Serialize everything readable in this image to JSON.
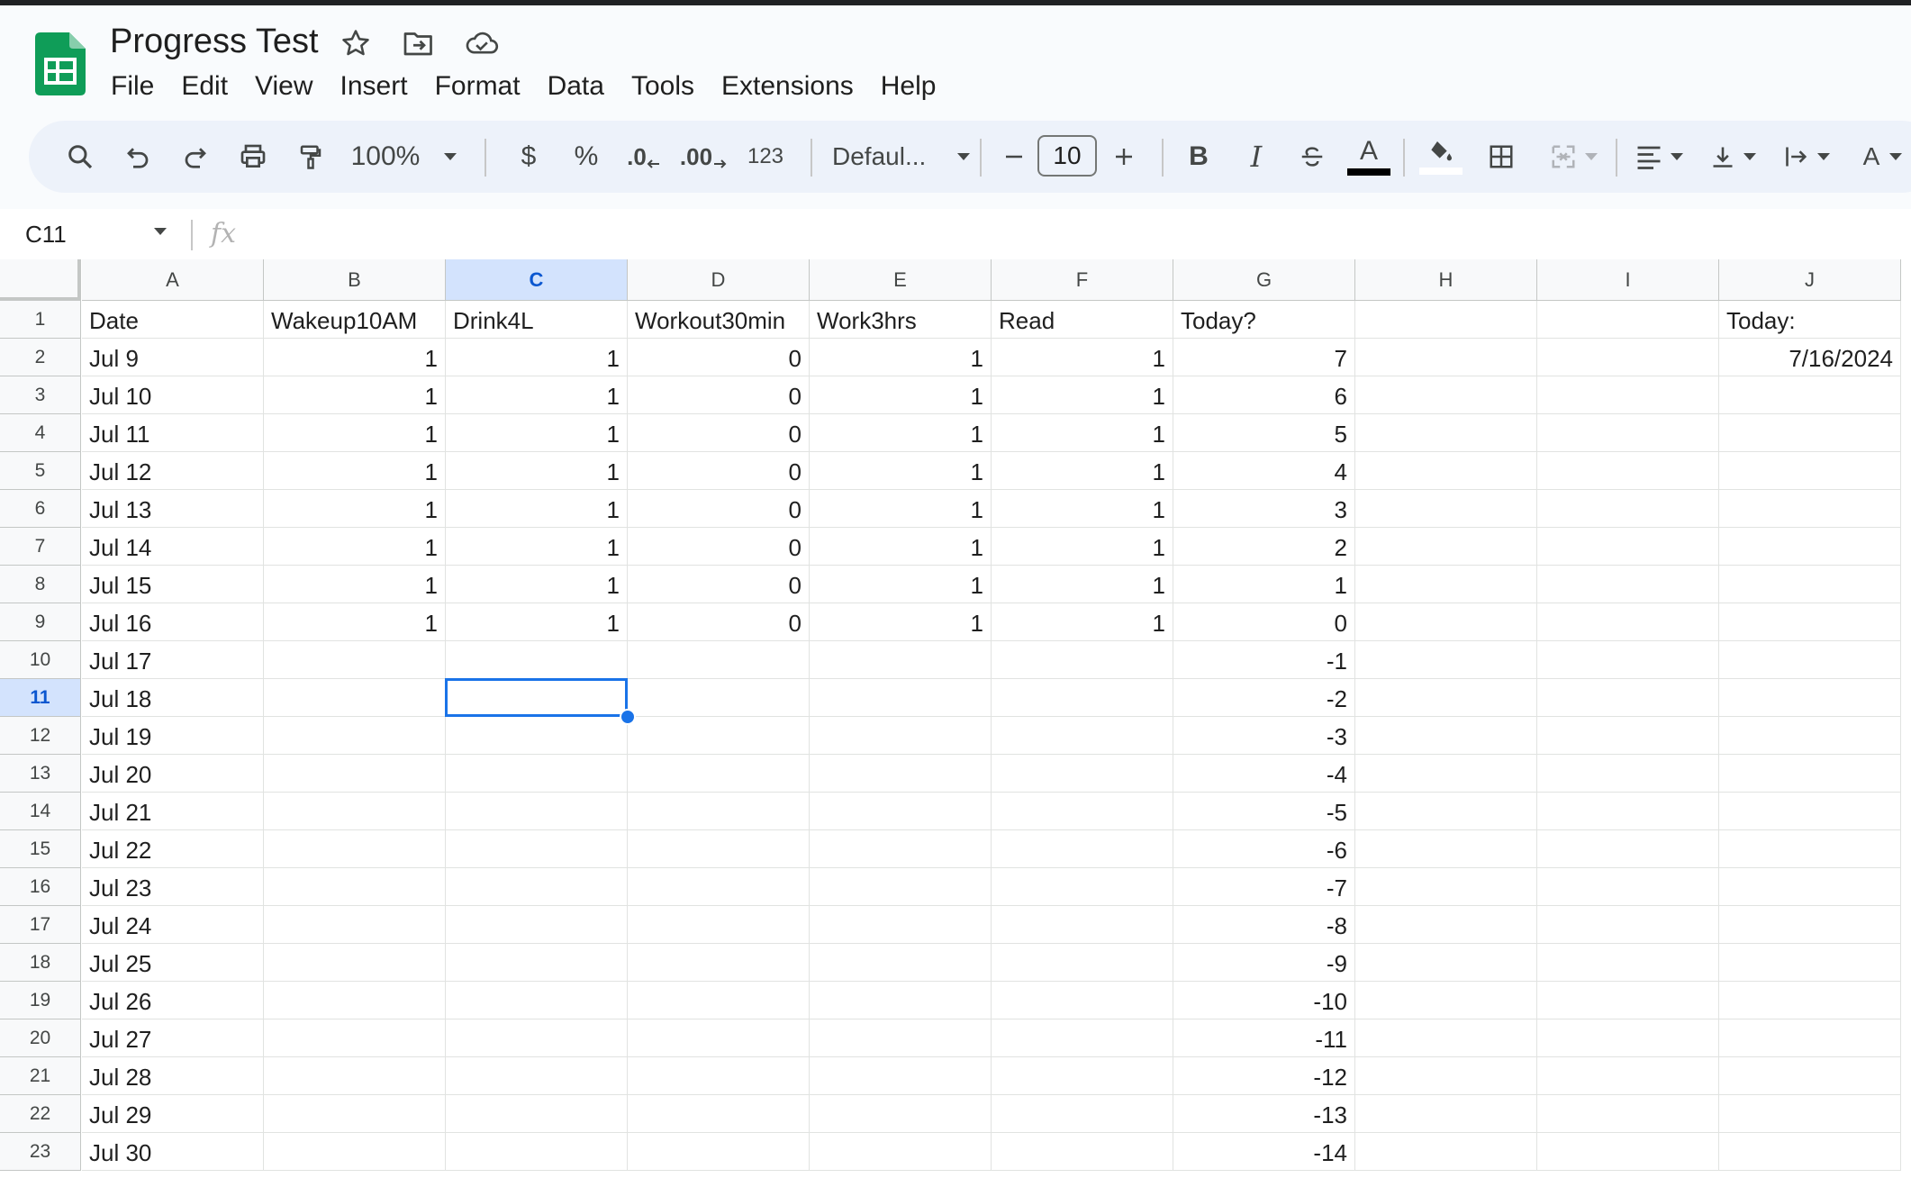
{
  "app": {
    "doc_title": "Progress Test",
    "menu": [
      "File",
      "Edit",
      "View",
      "Insert",
      "Format",
      "Data",
      "Tools",
      "Extensions",
      "Help"
    ],
    "title_icons": [
      "star-icon",
      "move-to-folder-icon",
      "cloud-status-icon"
    ]
  },
  "toolbar": {
    "zoom": "100%",
    "currency": "$",
    "percent": "%",
    "decrease_decimal": ".0",
    "increase_decimal": ".00",
    "more_formats": "123",
    "font": "Defaul...",
    "font_size": "10",
    "bold": "B",
    "italic": "I",
    "text_color_letter": "A",
    "rotation_letter": "A",
    "icons": [
      "search-icon",
      "undo-icon",
      "redo-icon",
      "print-icon",
      "paint-format-icon",
      "bold-icon",
      "italic-icon",
      "strikethrough-icon",
      "text-color-icon",
      "fill-color-icon",
      "borders-icon",
      "merge-cells-icon",
      "align-left-icon",
      "valign-bottom-icon",
      "text-wrap-icon",
      "text-rotation-icon"
    ]
  },
  "formula_bar": {
    "name_box": "C11",
    "fx_label": "fx",
    "value": ""
  },
  "sheet": {
    "columns": [
      "A",
      "B",
      "C",
      "D",
      "E",
      "F",
      "G",
      "H",
      "I",
      "J"
    ],
    "active_column": "C",
    "active_row": "11",
    "selected_cell": "C11",
    "row_numbers": [
      "1",
      "2",
      "3",
      "4",
      "5",
      "6",
      "7",
      "8",
      "9",
      "10",
      "11",
      "12",
      "13",
      "14",
      "15",
      "16",
      "17",
      "18",
      "19",
      "20",
      "21",
      "22",
      "23"
    ],
    "header_row": [
      "Date",
      "Wakeup10AM",
      "Drink4L",
      "Workout30min",
      "Work3hrs",
      "Read",
      "Today?",
      "",
      "",
      "Today:"
    ],
    "rows": [
      [
        "Jul 9",
        "1",
        "1",
        "0",
        "1",
        "1",
        "7",
        "",
        "",
        "7/16/2024"
      ],
      [
        "Jul 10",
        "1",
        "1",
        "0",
        "1",
        "1",
        "6",
        "",
        "",
        ""
      ],
      [
        "Jul 11",
        "1",
        "1",
        "0",
        "1",
        "1",
        "5",
        "",
        "",
        ""
      ],
      [
        "Jul 12",
        "1",
        "1",
        "0",
        "1",
        "1",
        "4",
        "",
        "",
        ""
      ],
      [
        "Jul 13",
        "1",
        "1",
        "0",
        "1",
        "1",
        "3",
        "",
        "",
        ""
      ],
      [
        "Jul 14",
        "1",
        "1",
        "0",
        "1",
        "1",
        "2",
        "",
        "",
        ""
      ],
      [
        "Jul 15",
        "1",
        "1",
        "0",
        "1",
        "1",
        "1",
        "",
        "",
        ""
      ],
      [
        "Jul 16",
        "1",
        "1",
        "0",
        "1",
        "1",
        "0",
        "",
        "",
        ""
      ],
      [
        "Jul 17",
        "",
        "",
        "",
        "",
        "",
        "-1",
        "",
        "",
        ""
      ],
      [
        "Jul 18",
        "",
        "",
        "",
        "",
        "",
        "-2",
        "",
        "",
        ""
      ],
      [
        "Jul 19",
        "",
        "",
        "",
        "",
        "",
        "-3",
        "",
        "",
        ""
      ],
      [
        "Jul 20",
        "",
        "",
        "",
        "",
        "",
        "-4",
        "",
        "",
        ""
      ],
      [
        "Jul 21",
        "",
        "",
        "",
        "",
        "",
        "-5",
        "",
        "",
        ""
      ],
      [
        "Jul 22",
        "",
        "",
        "",
        "",
        "",
        "-6",
        "",
        "",
        ""
      ],
      [
        "Jul 23",
        "",
        "",
        "",
        "",
        "",
        "-7",
        "",
        "",
        ""
      ],
      [
        "Jul 24",
        "",
        "",
        "",
        "",
        "",
        "-8",
        "",
        "",
        ""
      ],
      [
        "Jul 25",
        "",
        "",
        "",
        "",
        "",
        "-9",
        "",
        "",
        ""
      ],
      [
        "Jul 26",
        "",
        "",
        "",
        "",
        "",
        "-10",
        "",
        "",
        ""
      ],
      [
        "Jul 27",
        "",
        "",
        "",
        "",
        "",
        "-11",
        "",
        "",
        ""
      ],
      [
        "Jul 28",
        "",
        "",
        "",
        "",
        "",
        "-12",
        "",
        "",
        ""
      ],
      [
        "Jul 29",
        "",
        "",
        "",
        "",
        "",
        "-13",
        "",
        "",
        ""
      ],
      [
        "Jul 30",
        "",
        "",
        "",
        "",
        "",
        "-14",
        "",
        "",
        ""
      ]
    ]
  },
  "colors": {
    "accent": "#1a73e8",
    "sheets_green": "#0f9d58",
    "toolbar_bg": "#edf2fa"
  }
}
